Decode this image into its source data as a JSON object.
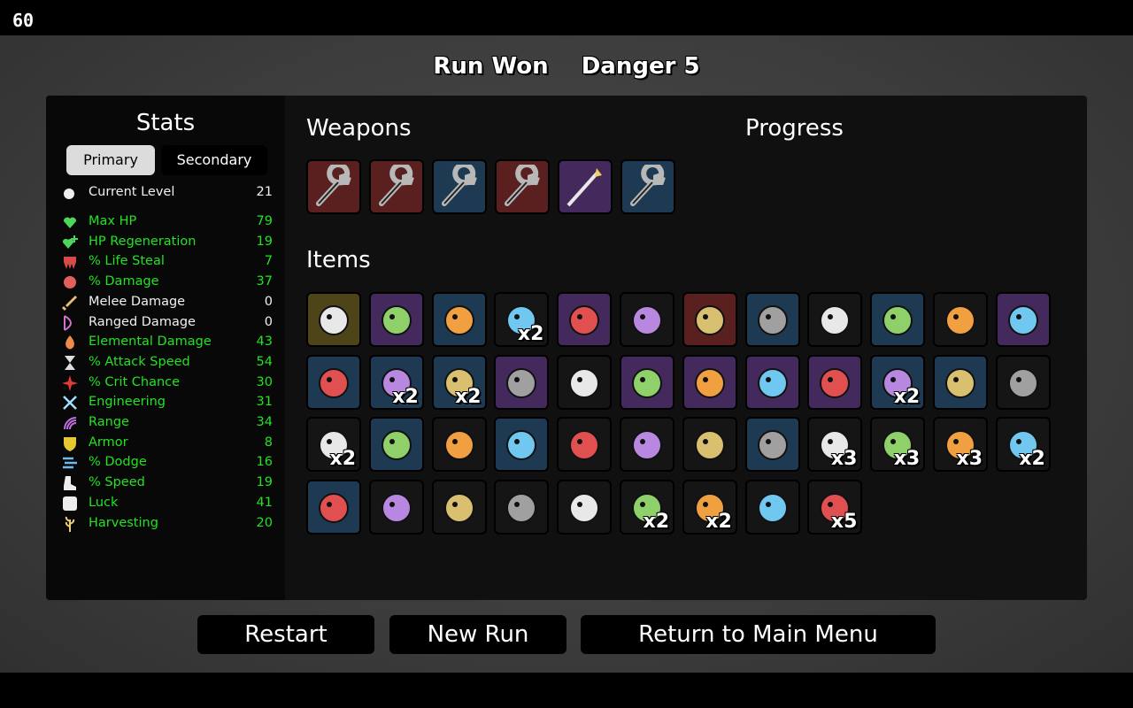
{
  "fps": "60",
  "header": {
    "result": "Run Won",
    "danger": "Danger 5"
  },
  "stats": {
    "title": "Stats",
    "tabs": {
      "primary": "Primary",
      "secondary": "Secondary"
    },
    "current_level": {
      "label": "Current Level",
      "value": "21",
      "icon": "level-icon"
    },
    "rows": [
      {
        "label": "Max HP",
        "value": "79",
        "color": "green",
        "icon": "heart-icon"
      },
      {
        "label": "HP Regeneration",
        "value": "19",
        "color": "green",
        "icon": "heart-plus-icon"
      },
      {
        "label": "% Life Steal",
        "value": "7",
        "color": "green",
        "icon": "fangs-icon"
      },
      {
        "label": "% Damage",
        "value": "37",
        "color": "green",
        "icon": "muscle-icon"
      },
      {
        "label": "Melee Damage",
        "value": "0",
        "color": "white",
        "icon": "sword-icon"
      },
      {
        "label": "Ranged Damage",
        "value": "0",
        "color": "white",
        "icon": "bow-icon"
      },
      {
        "label": "Elemental Damage",
        "value": "43",
        "color": "green",
        "icon": "flame-icon"
      },
      {
        "label": "% Attack Speed",
        "value": "54",
        "color": "green",
        "icon": "hourglass-icon"
      },
      {
        "label": "% Crit Chance",
        "value": "30",
        "color": "green",
        "icon": "crit-icon"
      },
      {
        "label": "Engineering",
        "value": "31",
        "color": "green",
        "icon": "wrench-cross-icon"
      },
      {
        "label": "Range",
        "value": "34",
        "color": "green",
        "icon": "range-icon"
      },
      {
        "label": "Armor",
        "value": "8",
        "color": "green",
        "icon": "shield-icon"
      },
      {
        "label": "% Dodge",
        "value": "16",
        "color": "green",
        "icon": "dodge-icon"
      },
      {
        "label": "% Speed",
        "value": "19",
        "color": "green",
        "icon": "boot-icon"
      },
      {
        "label": "Luck",
        "value": "41",
        "color": "green",
        "icon": "dice-icon"
      },
      {
        "label": "Harvesting",
        "value": "20",
        "color": "green",
        "icon": "wheat-icon"
      }
    ]
  },
  "weapons_title": "Weapons",
  "progress_title": "Progress",
  "items_title": "Items",
  "weapons": [
    {
      "icon": "wrench-icon",
      "tier": "red"
    },
    {
      "icon": "wrench-icon",
      "tier": "red"
    },
    {
      "icon": "wrench-icon",
      "tier": "blue"
    },
    {
      "icon": "wrench-icon",
      "tier": "red"
    },
    {
      "icon": "lightning-spear-icon",
      "tier": "purple"
    },
    {
      "icon": "wrench-icon",
      "tier": "blue"
    }
  ],
  "items": [
    {
      "icon": "egg-skull-icon",
      "tier": "gold",
      "qty": ""
    },
    {
      "icon": "wizard-icon",
      "tier": "purple",
      "qty": ""
    },
    {
      "icon": "castle-icon",
      "tier": "blue",
      "qty": ""
    },
    {
      "icon": "sprout-icon",
      "tier": "black",
      "qty": "x2"
    },
    {
      "icon": "halo-drone-icon",
      "tier": "purple",
      "qty": ""
    },
    {
      "icon": "snake-icon",
      "tier": "black",
      "qty": ""
    },
    {
      "icon": "binoculars-icon",
      "tier": "red",
      "qty": ""
    },
    {
      "icon": "medic-turret-icon",
      "tier": "blue",
      "qty": ""
    },
    {
      "icon": "slime-icon",
      "tier": "black",
      "qty": ""
    },
    {
      "icon": "alert-cloud-icon",
      "tier": "blue",
      "qty": ""
    },
    {
      "icon": "tree-icon",
      "tier": "black",
      "qty": ""
    },
    {
      "icon": "sad-apple-icon",
      "tier": "purple",
      "qty": ""
    },
    {
      "icon": "mosquito-icon",
      "tier": "blue",
      "qty": ""
    },
    {
      "icon": "campfire-icon",
      "tier": "blue",
      "qty": "x2"
    },
    {
      "icon": "scarf-icon",
      "tier": "blue",
      "qty": "x2"
    },
    {
      "icon": "rat-icon",
      "tier": "purple",
      "qty": ""
    },
    {
      "icon": "boxing-glove-icon",
      "tier": "black",
      "qty": ""
    },
    {
      "icon": "tools-icon",
      "tier": "purple",
      "qty": ""
    },
    {
      "icon": "crate-icon",
      "tier": "purple",
      "qty": ""
    },
    {
      "icon": "turret-icon",
      "tier": "purple",
      "qty": ""
    },
    {
      "icon": "ring-icon",
      "tier": "purple",
      "qty": ""
    },
    {
      "icon": "garden-icon",
      "tier": "blue",
      "qty": "x2"
    },
    {
      "icon": "potion-icon",
      "tier": "blue",
      "qty": ""
    },
    {
      "icon": "book-icon",
      "tier": "black",
      "qty": ""
    },
    {
      "icon": "monkey-icon",
      "tier": "black",
      "qty": "x2"
    },
    {
      "icon": "cocoon-icon",
      "tier": "blue",
      "qty": ""
    },
    {
      "icon": "disc-icon",
      "tier": "black",
      "qty": ""
    },
    {
      "icon": "scroll-icon",
      "tier": "blue",
      "qty": ""
    },
    {
      "icon": "ghost-icon",
      "tier": "black",
      "qty": ""
    },
    {
      "icon": "butterfly-icon",
      "tier": "black",
      "qty": ""
    },
    {
      "icon": "green-blob-icon",
      "tier": "black",
      "qty": ""
    },
    {
      "icon": "glasses-icon",
      "tier": "blue",
      "qty": ""
    },
    {
      "icon": "claw-icon",
      "tier": "black",
      "qty": "x3"
    },
    {
      "icon": "candle-icon",
      "tier": "black",
      "qty": "x3"
    },
    {
      "icon": "sickle-icon",
      "tier": "black",
      "qty": "x3"
    },
    {
      "icon": "cake-icon",
      "tier": "black",
      "qty": "x2"
    },
    {
      "icon": "lifebuoy-icon",
      "tier": "blue",
      "qty": ""
    },
    {
      "icon": "jar-icon",
      "tier": "black",
      "qty": ""
    },
    {
      "icon": "tooth-icon",
      "tier": "black",
      "qty": ""
    },
    {
      "icon": "pencil-icon",
      "tier": "black",
      "qty": ""
    },
    {
      "icon": "flamingo-icon",
      "tier": "black",
      "qty": ""
    },
    {
      "icon": "branch-icon",
      "tier": "black",
      "qty": "x2"
    },
    {
      "icon": "duck-icon",
      "tier": "black",
      "qty": "x2"
    },
    {
      "icon": "banknote-icon",
      "tier": "black",
      "qty": ""
    },
    {
      "icon": "speaker-icon",
      "tier": "black",
      "qty": "x5"
    }
  ],
  "buttons": {
    "restart": "Restart",
    "new_run": "New Run",
    "main_menu": "Return to Main Menu"
  }
}
